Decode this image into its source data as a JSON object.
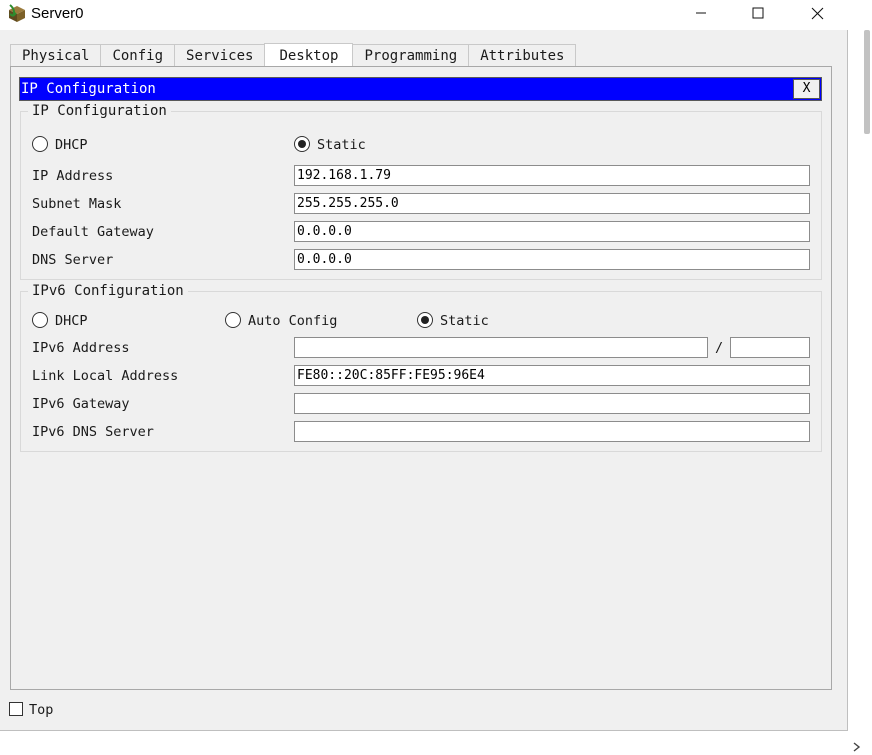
{
  "window": {
    "title": "Server0",
    "controls": {
      "minimize": "minimize",
      "maximize": "maximize",
      "close": "close"
    }
  },
  "tabs": [
    {
      "label": "Physical",
      "active": false
    },
    {
      "label": "Config",
      "active": false
    },
    {
      "label": "Services",
      "active": false
    },
    {
      "label": "Desktop",
      "active": true
    },
    {
      "label": "Programming",
      "active": false
    },
    {
      "label": "Attributes",
      "active": false
    }
  ],
  "ip_config_bar": {
    "title": "IP Configuration",
    "close_label": "X"
  },
  "ipv4": {
    "legend": "IP Configuration",
    "dhcp_label": "DHCP",
    "static_label": "Static",
    "mode": "Static",
    "ip_address_label": "IP Address",
    "ip_address": "192.168.1.79",
    "subnet_mask_label": "Subnet Mask",
    "subnet_mask": "255.255.255.0",
    "default_gateway_label": "Default Gateway",
    "default_gateway": "0.0.0.0",
    "dns_server_label": "DNS Server",
    "dns_server": "0.0.0.0"
  },
  "ipv6": {
    "legend": "IPv6 Configuration",
    "dhcp_label": "DHCP",
    "auto_config_label": "Auto Config",
    "static_label": "Static",
    "mode": "Static",
    "ipv6_address_label": "IPv6 Address",
    "ipv6_address": "",
    "prefix_separator": "/",
    "prefix_length": "",
    "link_local_label": "Link Local Address",
    "link_local": "FE80::20C:85FF:FE95:96E4",
    "gateway_label": "IPv6 Gateway",
    "gateway": "",
    "dns_server_label": "IPv6 DNS Server",
    "dns_server": ""
  },
  "footer": {
    "top_label": "Top",
    "top_checked": false
  },
  "icons": [
    "app-icon",
    "minimize-icon",
    "maximize-icon",
    "close-icon",
    "chevron-right-icon"
  ],
  "colors": {
    "ip_bar": "#0000ff",
    "window_bg": "#f0f0f0"
  }
}
